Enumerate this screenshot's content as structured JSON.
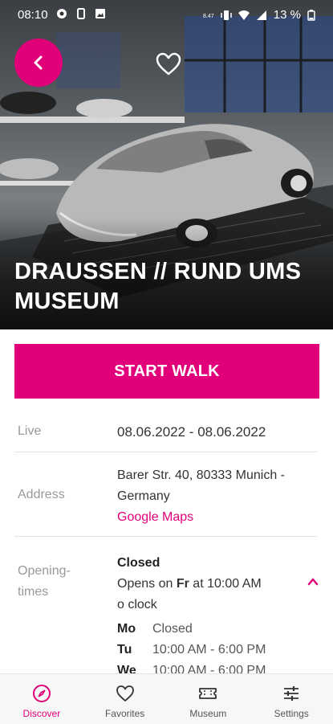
{
  "status_bar": {
    "time": "08:10",
    "signal_text": "B/KB/s",
    "battery": "13 %"
  },
  "hero": {
    "title": "DRAUßEN // RUND UMS MUSEUM"
  },
  "cta": {
    "label": "START WALK"
  },
  "info": {
    "live": {
      "label": "Live",
      "value": "08.06.2022 - 08.06.2022"
    },
    "address": {
      "label": "Address",
      "line1": "Barer Str. 40, 80333 Munich -",
      "line2": "Germany",
      "maps_link": "Google Maps"
    },
    "opening": {
      "label_line1": "Opening-",
      "label_line2": "times",
      "status": "Closed",
      "next_prefix": "Opens on",
      "next_day": "Fr",
      "next_suffix": "at 10:00 AM",
      "next_line2": "o clock",
      "schedule": [
        {
          "day": "Mo",
          "hours": "Closed"
        },
        {
          "day": "Tu",
          "hours": "10:00 AM - 6:00 PM"
        },
        {
          "day": "We",
          "hours": "10:00 AM - 6:00 PM"
        }
      ]
    }
  },
  "bottom_nav": [
    {
      "label": "Discover",
      "icon": "compass-icon",
      "active": true
    },
    {
      "label": "Favorites",
      "icon": "heart-icon",
      "active": false
    },
    {
      "label": "Museum",
      "icon": "ticket-icon",
      "active": false
    },
    {
      "label": "Settings",
      "icon": "sliders-icon",
      "active": false
    }
  ],
  "colors": {
    "accent": "#e2007a"
  }
}
